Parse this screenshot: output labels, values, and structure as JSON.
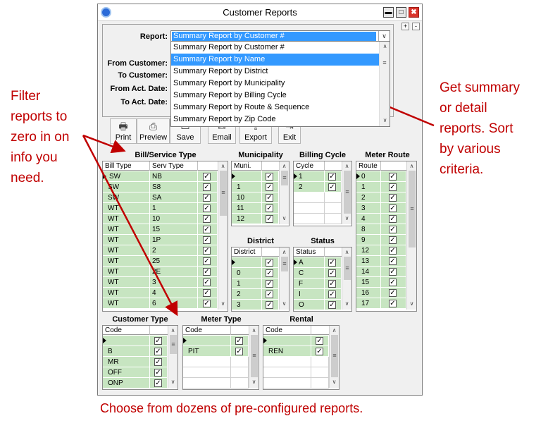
{
  "window": {
    "title": "Customer Reports",
    "buttons": {
      "minimize": "▬",
      "maximize": "□",
      "close": "✖",
      "plus": "+",
      "minus": "-"
    }
  },
  "form": {
    "labels": {
      "report": "Report:",
      "from_customer": "From Customer:",
      "to_customer": "To Customer:",
      "from_act_date": "From Act. Date:",
      "to_act_date": "To Act. Date:"
    },
    "report_value": "Summary Report by Customer #",
    "dropdown_options": [
      "Summary Report by Customer #",
      "Summary Report by Name",
      "Summary Report by District",
      "Summary Report by Municipality",
      "Summary Report by Billing Cycle",
      "Summary Report by Route & Sequence",
      "Summary Report by Zip Code"
    ],
    "highlighted_option": 1
  },
  "toolbar": {
    "buttons": [
      {
        "label": "Print",
        "icon": "printer-icon"
      },
      {
        "label": "Preview",
        "icon": "preview-icon"
      },
      {
        "label": "Save",
        "icon": "save-icon"
      },
      {
        "label": "Email",
        "icon": "email-icon"
      },
      {
        "label": "Export",
        "icon": "export-icon"
      },
      {
        "label": "Exit",
        "icon": "exit-icon"
      }
    ]
  },
  "grids": {
    "bill_service": {
      "title": "Bill/Service Type",
      "headers": [
        "Bill Type",
        "Serv Type"
      ],
      "rows": [
        [
          "SW",
          "NB"
        ],
        [
          "SW",
          "S8"
        ],
        [
          "SW",
          "SA"
        ],
        [
          "WT",
          "1"
        ],
        [
          "WT",
          "10"
        ],
        [
          "WT",
          "15"
        ],
        [
          "WT",
          "1P"
        ],
        [
          "WT",
          "2"
        ],
        [
          "WT",
          "25"
        ],
        [
          "WT",
          "2E"
        ],
        [
          "WT",
          "3"
        ],
        [
          "WT",
          "4"
        ],
        [
          "WT",
          "6"
        ]
      ]
    },
    "municipality": {
      "title": "Municipality",
      "headers": [
        "Muni."
      ],
      "rows": [
        "",
        "1",
        "10",
        "11",
        "12"
      ]
    },
    "billing_cycle": {
      "title": "Billing Cycle",
      "headers": [
        "Cycle"
      ],
      "rows": [
        "1",
        "2"
      ]
    },
    "meter_route": {
      "title": "Meter Route",
      "headers": [
        "Route"
      ],
      "rows": [
        "0",
        "1",
        "2",
        "3",
        "4",
        "8",
        "9",
        "12",
        "13",
        "14",
        "15",
        "16",
        "17"
      ]
    },
    "district": {
      "title": "District",
      "headers": [
        "District"
      ],
      "rows": [
        "",
        "0",
        "1",
        "2",
        "3"
      ]
    },
    "status": {
      "title": "Status",
      "headers": [
        "Status"
      ],
      "rows": [
        "A",
        "C",
        "F",
        "I",
        "O"
      ]
    },
    "customer_type": {
      "title": "Customer Type",
      "headers": [
        "Code"
      ],
      "rows": [
        "",
        "B",
        "MR",
        "OFF",
        "ONP"
      ]
    },
    "meter_type": {
      "title": "Meter Type",
      "headers": [
        "Code"
      ],
      "rows": [
        "",
        "PIT"
      ]
    },
    "rental": {
      "title": "Rental",
      "headers": [
        "Code"
      ],
      "rows": [
        "",
        "REN"
      ]
    }
  },
  "annotations": {
    "left": [
      "Filter",
      "reports to",
      "zero in on",
      "info you",
      "need."
    ],
    "right": [
      "Get summary",
      "or detail",
      "reports.  Sort",
      "by various",
      "criteria."
    ],
    "bottom": "Choose from dozens of pre-configured reports."
  },
  "colors": {
    "accent": "#3399ff",
    "row_fill": "#c7e5c1",
    "annotation": "#c00000"
  }
}
